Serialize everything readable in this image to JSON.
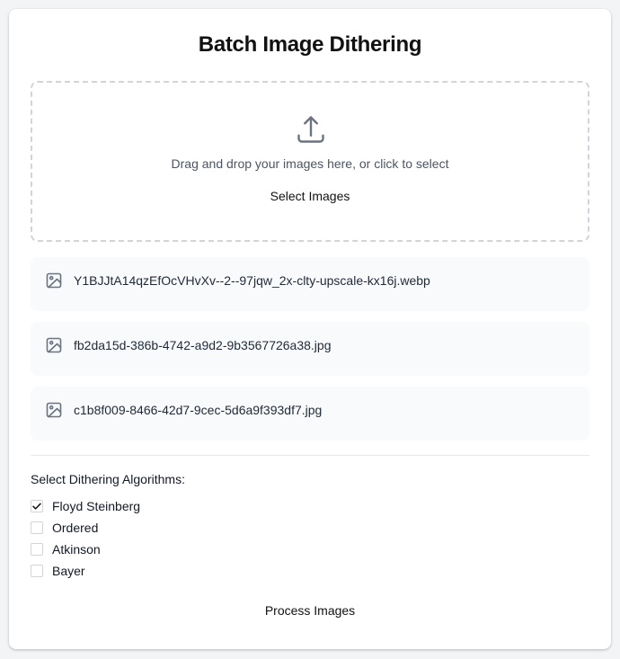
{
  "page": {
    "title": "Batch Image Dithering"
  },
  "dropzone": {
    "icon": "upload-icon",
    "instruction": "Drag and drop your images here, or click to select",
    "select_button_label": "Select Images"
  },
  "files": [
    {
      "icon": "image-icon",
      "name": "Y1BJJtA14qzEfOcVHvXv--2--97jqw_2x-clty-upscale-kx16j.webp"
    },
    {
      "icon": "image-icon",
      "name": "fb2da15d-386b-4742-a9d2-9b3567726a38.jpg"
    },
    {
      "icon": "image-icon",
      "name": "c1b8f009-8466-42d7-9cec-5d6a9f393df7.jpg"
    }
  ],
  "algorithms": {
    "heading": "Select Dithering Algorithms:",
    "options": [
      {
        "label": "Floyd Steinberg",
        "checked": true
      },
      {
        "label": "Ordered",
        "checked": false
      },
      {
        "label": "Atkinson",
        "checked": false
      },
      {
        "label": "Bayer",
        "checked": false
      }
    ]
  },
  "actions": {
    "process_label": "Process Images"
  },
  "colors": {
    "background": "#f3f4f6",
    "card": "#ffffff",
    "file_row": "#f9fafb",
    "icon_gray": "#6b7280",
    "dashed_border": "#d1d5db"
  }
}
